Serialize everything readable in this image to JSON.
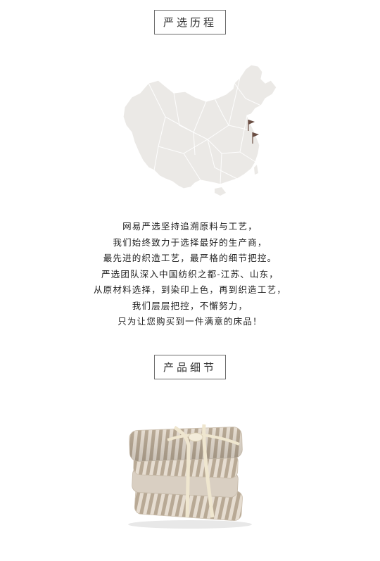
{
  "sections": {
    "history_title": "严选历程",
    "details_title": "产品细节"
  },
  "story": {
    "lines": [
      "网易严选坚持追溯原料与工艺，",
      "我们始终致力于选择最好的生产商，",
      "最先进的织造工艺，最严格的细节把控。",
      "严选团队深入中国纺织之都-江苏、山东，",
      "从原材料选择，到染印上色，再到织造工艺，",
      "我们层层把控，不懈努力，",
      "只为让您购买到一件满意的床品！"
    ]
  },
  "map": {
    "fill_color": "#ebe9e6",
    "border_color": "#ffffff",
    "flag_color": "#6b4f44"
  },
  "product": {
    "icon": "folded-striped-bedding",
    "stripe_color": "#b8a995",
    "base_color": "#d9cfc2",
    "ribbon_color": "#efe6cf"
  }
}
